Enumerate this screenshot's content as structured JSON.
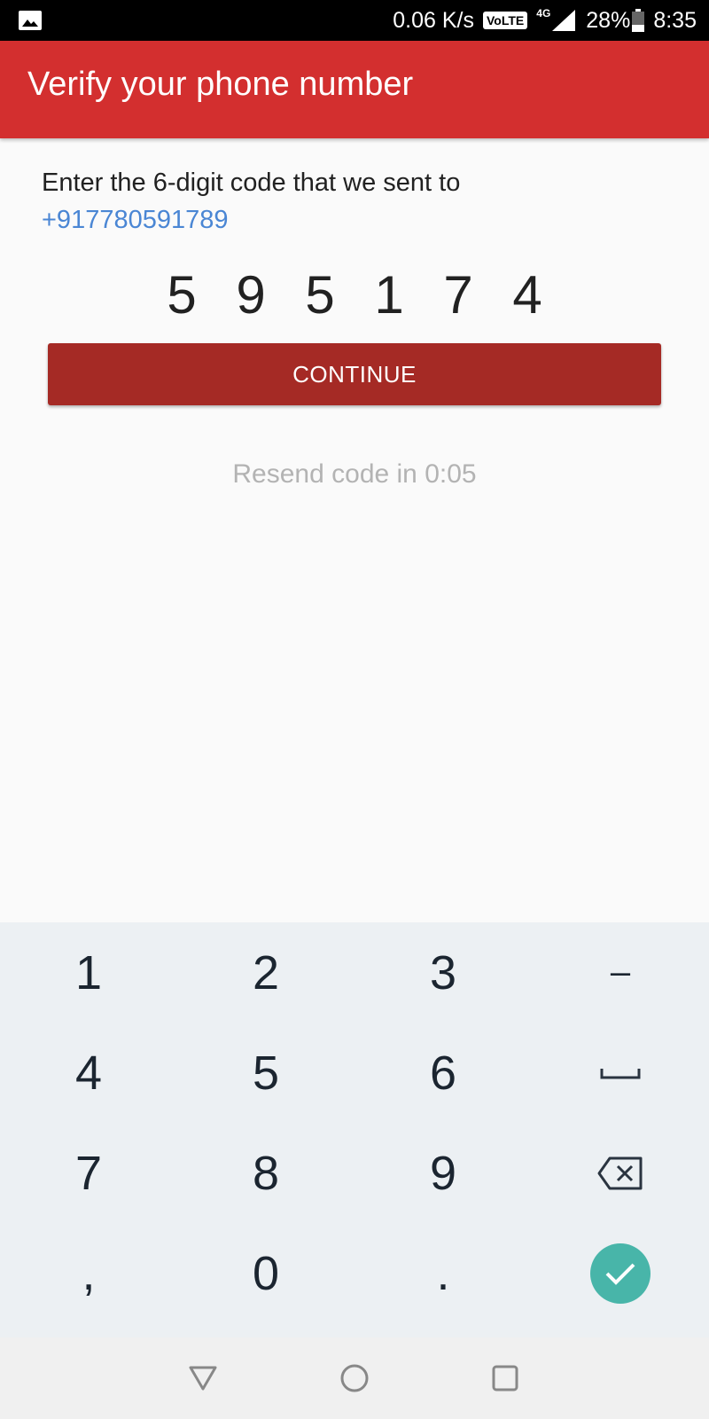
{
  "status_bar": {
    "speed": "0.06 K/s",
    "volte": "VoLTE",
    "network": "4G",
    "battery": "28%",
    "time": "8:35"
  },
  "app_bar": {
    "title": "Verify your phone number"
  },
  "prompt": "Enter the 6-digit code that we sent to",
  "phone": "+917780591789",
  "code_digits": [
    "5",
    "9",
    "5",
    "1",
    "7",
    "4"
  ],
  "continue_label": "CONTINUE",
  "resend_text": "Resend code in 0:05",
  "keyboard": {
    "keys": [
      "1",
      "2",
      "3",
      "–",
      "4",
      "5",
      "6",
      "7",
      "8",
      "9",
      ",",
      "0",
      "."
    ]
  },
  "colors": {
    "app_bar": "#d32f2f",
    "continue_button": "#a52a25",
    "link": "#4a86d4",
    "ok_button": "#48b5a9"
  },
  "icons": {
    "status_left": "image-icon",
    "signal": "signal-icon",
    "battery": "battery-icon",
    "space": "space-key-icon",
    "backspace": "backspace-icon",
    "done": "check-icon",
    "nav_back": "back-triangle-icon",
    "nav_home": "home-circle-icon",
    "nav_recents": "recents-square-icon"
  }
}
